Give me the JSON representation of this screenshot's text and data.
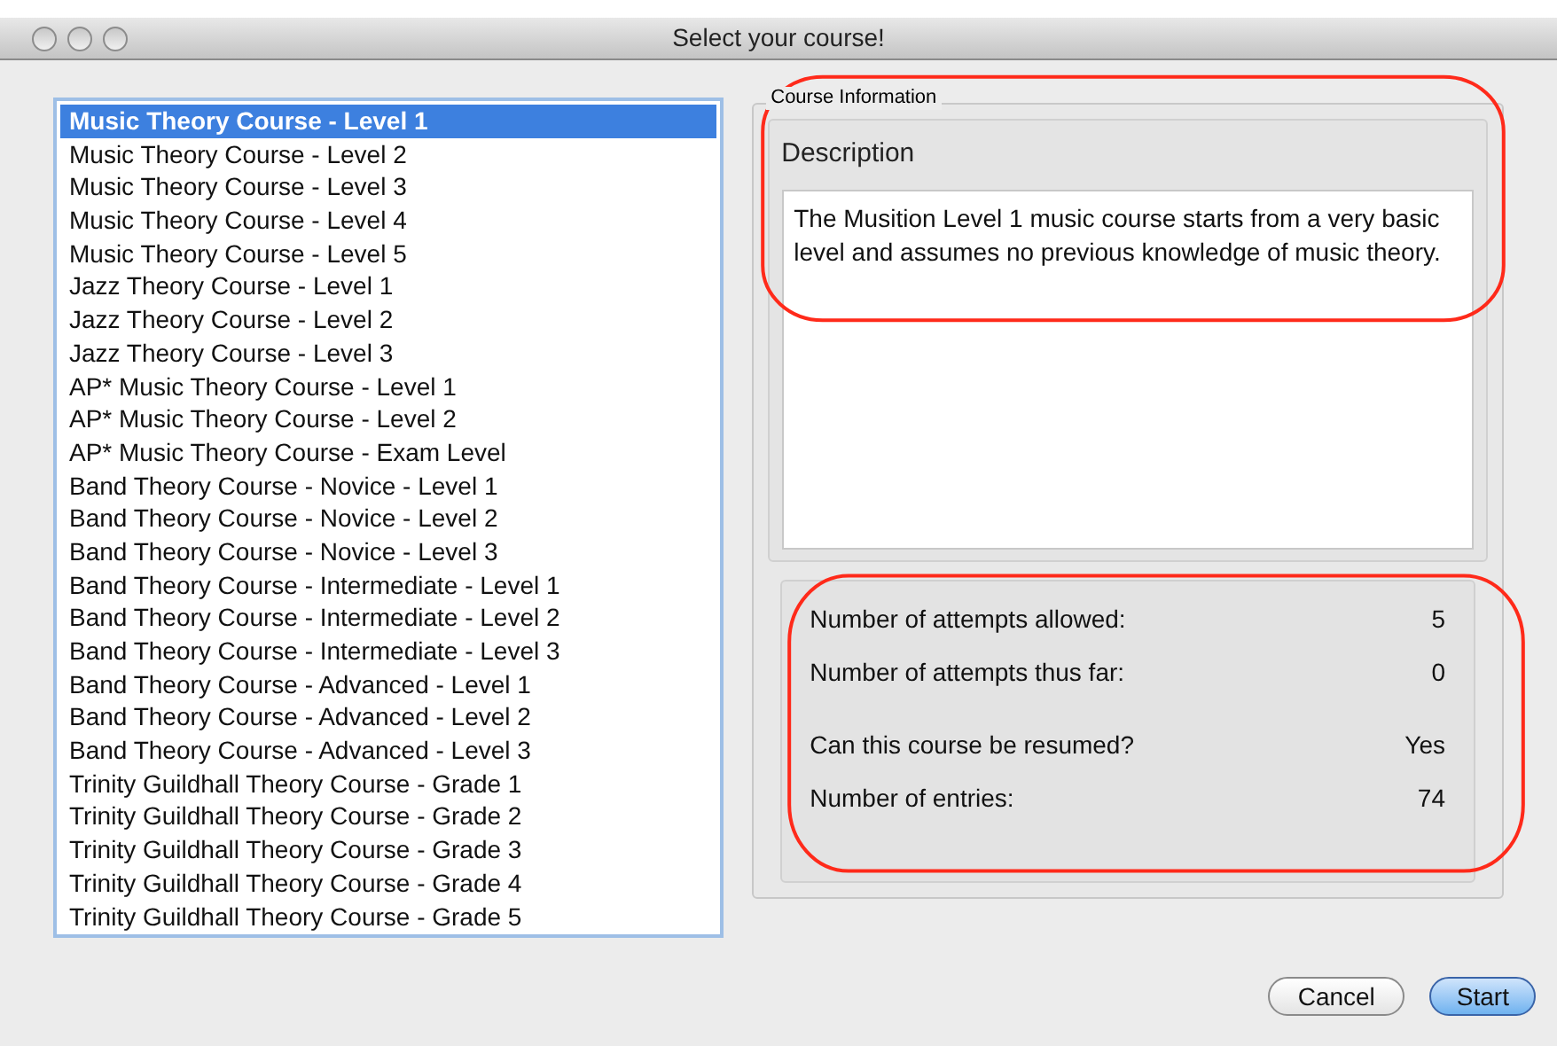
{
  "window": {
    "title": "Select your course!"
  },
  "courses": [
    {
      "label": "Music Theory Course - Level 1",
      "selected": true
    },
    {
      "label": "Music Theory Course - Level 2",
      "selected": false
    },
    {
      "label": "Music Theory Course - Level 3",
      "selected": false
    },
    {
      "label": "Music Theory Course - Level 4",
      "selected": false
    },
    {
      "label": "Music Theory Course - Level 5",
      "selected": false
    },
    {
      "label": "Jazz Theory Course - Level 1",
      "selected": false
    },
    {
      "label": "Jazz Theory Course - Level 2",
      "selected": false
    },
    {
      "label": "Jazz Theory Course - Level 3",
      "selected": false
    },
    {
      "label": "AP* Music Theory Course - Level 1",
      "selected": false
    },
    {
      "label": "AP* Music Theory Course - Level 2",
      "selected": false
    },
    {
      "label": "AP* Music Theory Course - Exam Level",
      "selected": false
    },
    {
      "label": "Band Theory Course - Novice - Level 1",
      "selected": false
    },
    {
      "label": "Band Theory Course - Novice - Level 2",
      "selected": false
    },
    {
      "label": "Band Theory Course - Novice - Level 3",
      "selected": false
    },
    {
      "label": "Band Theory Course - Intermediate - Level 1",
      "selected": false
    },
    {
      "label": "Band Theory Course - Intermediate - Level 2",
      "selected": false
    },
    {
      "label": "Band Theory Course - Intermediate - Level 3",
      "selected": false
    },
    {
      "label": "Band Theory Course - Advanced - Level 1",
      "selected": false
    },
    {
      "label": "Band Theory Course - Advanced - Level 2",
      "selected": false
    },
    {
      "label": "Band Theory Course - Advanced - Level 3",
      "selected": false
    },
    {
      "label": "Trinity Guildhall Theory Course - Grade 1",
      "selected": false
    },
    {
      "label": "Trinity Guildhall Theory Course - Grade 2",
      "selected": false
    },
    {
      "label": "Trinity Guildhall Theory Course - Grade 3",
      "selected": false
    },
    {
      "label": "Trinity Guildhall Theory Course - Grade 4",
      "selected": false
    },
    {
      "label": "Trinity Guildhall Theory Course - Grade 5",
      "selected": false
    }
  ],
  "course_information": {
    "title": "Course Information",
    "description_heading": "Description",
    "description": "The Musition Level 1 music course starts from a very basic level and assumes no previous knowledge of music theory.",
    "stat_groups": [
      [
        {
          "label": "Number of attempts allowed:",
          "value": "5"
        },
        {
          "label": "Number of attempts thus far:",
          "value": "0"
        }
      ],
      [
        {
          "label": "Can this course be resumed?",
          "value": "Yes"
        },
        {
          "label": "Number of entries:",
          "value": "74"
        }
      ]
    ]
  },
  "highlights": {
    "description_circled": true,
    "stats_circled": true
  },
  "buttons": [
    {
      "label": "Cancel",
      "default": false
    },
    {
      "label": "Start",
      "default": true
    }
  ]
}
